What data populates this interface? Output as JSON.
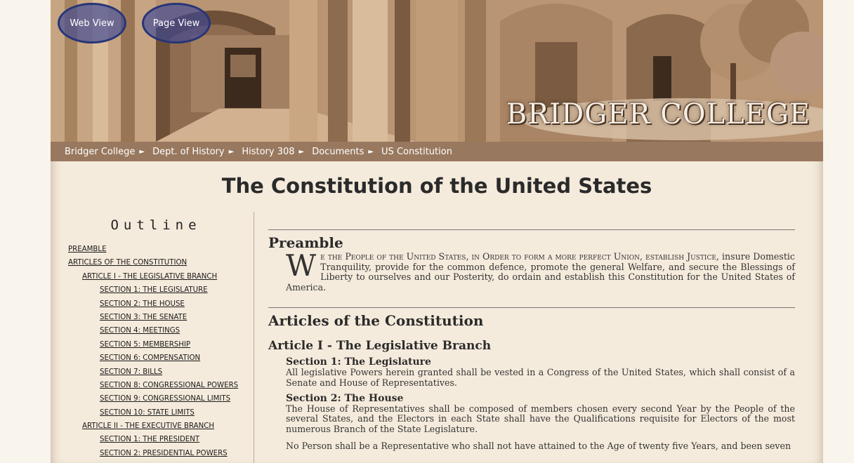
{
  "banner": {
    "web_view_label": "Web View",
    "page_view_label": "Page View",
    "brand": "BRIDGER COLLEGE"
  },
  "breadcrumb": [
    {
      "label": "Bridger College"
    },
    {
      "label": "Dept. of History"
    },
    {
      "label": "History 308"
    },
    {
      "label": "Documents"
    },
    {
      "label": "US Constitution"
    }
  ],
  "breadcrumb_separator": "►",
  "page_title": "The Constitution of the United States",
  "outline": {
    "heading": "Outline",
    "items": [
      {
        "label": "PREAMBLE",
        "level": 0
      },
      {
        "label": "ARTICLES OF THE CONSTITUTION",
        "level": 0
      },
      {
        "label": "ARTICLE I - THE LEGISLATIVE BRANCH",
        "level": 1
      },
      {
        "label": "SECTION 1: THE LEGISLATURE",
        "level": 2
      },
      {
        "label": "SECTION 2: THE HOUSE",
        "level": 2
      },
      {
        "label": "SECTION 3: THE SENATE",
        "level": 2
      },
      {
        "label": "SECTION 4: MEETINGS",
        "level": 2
      },
      {
        "label": "SECTION 5: MEMBERSHIP",
        "level": 2
      },
      {
        "label": "SECTION 6: COMPENSATION",
        "level": 2
      },
      {
        "label": "SECTION 7: BILLS",
        "level": 2
      },
      {
        "label": "SECTION 8: CONGRESSIONAL POWERS",
        "level": 2
      },
      {
        "label": "SECTION 9: CONGRESSIONAL LIMITS",
        "level": 2
      },
      {
        "label": "SECTION 10: STATE LIMITS",
        "level": 2
      },
      {
        "label": "ARTICLE II - THE EXECUTIVE BRANCH",
        "level": 1
      },
      {
        "label": "SECTION 1: THE PRESIDENT",
        "level": 2
      },
      {
        "label": "SECTION 2: PRESIDENTIAL POWERS",
        "level": 2
      }
    ]
  },
  "content": {
    "preamble": {
      "heading": "Preamble",
      "dropcap": "W",
      "smallcaps_lead": "e the People of the United States, in Order to form a more perfect Union, establish Justice,",
      "text": "insure Domestic Tranquility, provide for the common defence, promote the general Welfare, and secure the Blessings of Liberty to ourselves and our Posterity, do ordain and establish this Constitution for the United States of America."
    },
    "articles_heading": "Articles of the Constitution",
    "article1": {
      "heading": "Article I - The Legislative Branch",
      "section1": {
        "heading": "Section 1: The Legislature",
        "text": "All legislative Powers herein granted shall be vested in a Congress of the United States, which shall consist of a Senate and House of Representatives."
      },
      "section2": {
        "heading": "Section 2: The House",
        "text": "The House of Representatives shall be composed of members chosen every second Year by the People of the several States, and the Electors in each State shall have the Qualifications requisite for Electors of the most numerous Branch of the State Legislature.",
        "text2": "No Person shall be a Representative who shall not have attained to the Age of twenty five Years, and been seven"
      }
    }
  }
}
